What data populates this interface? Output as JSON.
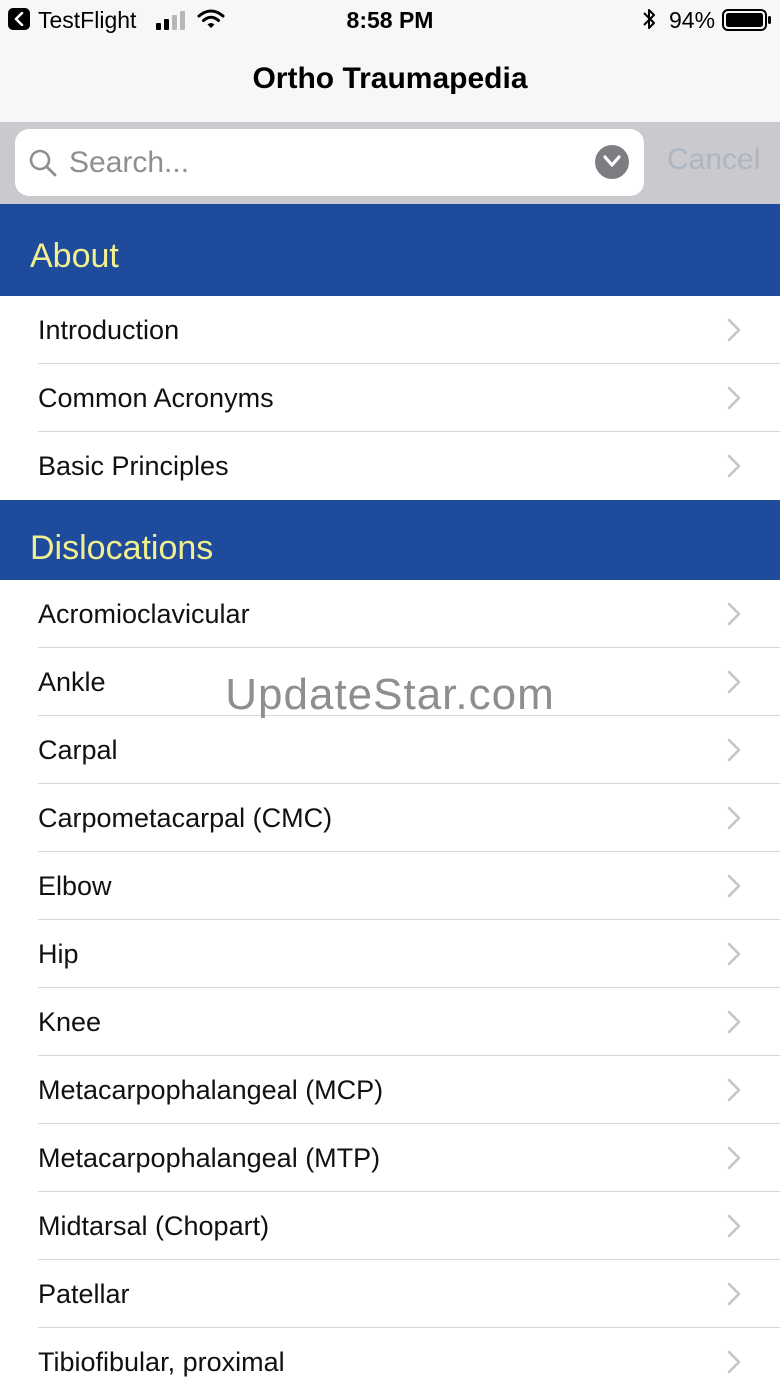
{
  "status_bar": {
    "back_app": "TestFlight",
    "time": "8:58 PM",
    "battery": "94%"
  },
  "nav": {
    "title": "Ortho Traumapedia"
  },
  "search": {
    "placeholder": "Search...",
    "value": "",
    "cancel_label": "Cancel"
  },
  "sections": [
    {
      "title": "About",
      "items": [
        "Introduction",
        "Common Acronyms",
        "Basic Principles"
      ]
    },
    {
      "title": "Dislocations",
      "items": [
        "Acromioclavicular",
        "Ankle",
        "Carpal",
        "Carpometacarpal (CMC)",
        "Elbow",
        "Hip",
        "Knee",
        "Metacarpophalangeal (MCP)",
        "Metacarpophalangeal (MTP)",
        "Midtarsal (Chopart)",
        "Patellar",
        "Tibiofibular, proximal"
      ]
    }
  ],
  "watermark": "UpdateStar.com",
  "colors": {
    "section_bg": "#1e4b9b",
    "section_text": "#f1ef8f",
    "search_bar_bg": "#c9c9ce",
    "cancel_text": "#aeb6c2"
  },
  "icons": {
    "back": "back-chevron-icon",
    "signal": "cellular-signal-icon",
    "wifi": "wifi-icon",
    "bluetooth": "bluetooth-icon",
    "battery": "battery-icon",
    "search": "search-icon",
    "dropdown": "chevron-down-circle-icon",
    "row": "chevron-right-icon"
  }
}
